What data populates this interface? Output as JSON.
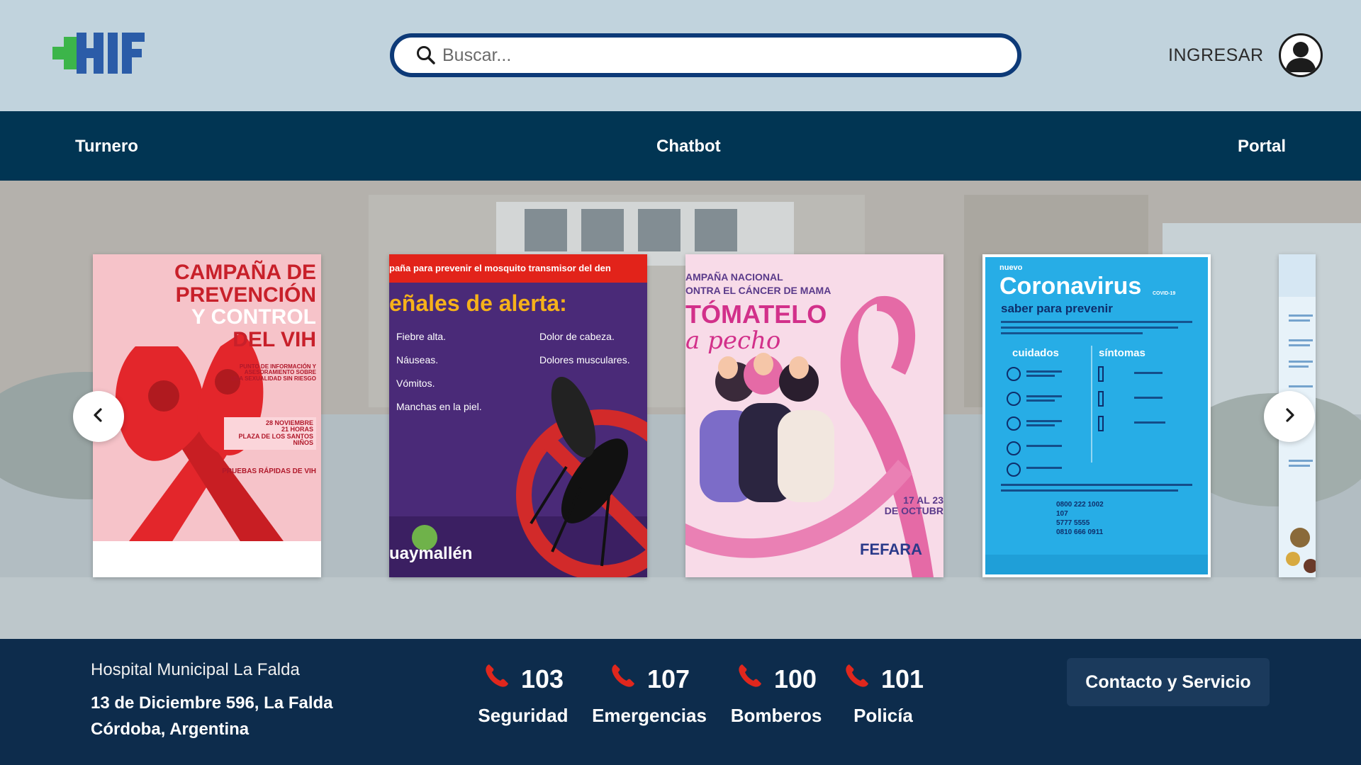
{
  "header": {
    "logo_text": "HIF",
    "search": {
      "placeholder": "Buscar..."
    },
    "login_label": "INGRESAR"
  },
  "navbar": {
    "items": [
      {
        "label": "Turnero"
      },
      {
        "label": "Chatbot"
      },
      {
        "label": "Portal"
      }
    ]
  },
  "carousel": {
    "slides": [
      {
        "lines": [
          "CAMPAÑA DE",
          "PREVENCIÓN",
          "Y CONTROL",
          "DEL VIH"
        ],
        "small": [
          "PUNTO DE INFORMACIÓN Y",
          "ASESORAMIENTO SOBRE",
          "UNA SEXUALIDAD SIN RIESGO"
        ],
        "date": [
          "28 NOVIEMBRE",
          "21 HORAS",
          "PLAZA DE LOS SANTOS NIÑOS"
        ],
        "tests": "PRUEBAS RÁPIDAS DE VIH"
      },
      {
        "banner": "paña para prevenir el mosquito transmisor del den",
        "heading": "eñales de alerta:",
        "signs_left": [
          "Fiebre alta.",
          "Náuseas.",
          "Vómitos.",
          "Manchas en la piel."
        ],
        "signs_right": [
          "Dolor de cabeza.",
          "Dolores musculares."
        ],
        "brand": "uaymallén"
      },
      {
        "line1": "AMPAÑA NACIONAL",
        "line2": "ONTRA EL CÁNCER DE MAMA",
        "title": "TÓMATELO",
        "subtitle": "a pecho",
        "date": [
          "17 AL 23",
          "DE OCTUBR"
        ],
        "brand": "FEFARA"
      },
      {
        "tag": "nuevo",
        "title": "Coronavirus",
        "title_sup": "COVID-19",
        "subtitle": "saber para prevenir",
        "col1": "cuidados",
        "col2": "síntomas",
        "phones": [
          "0800 222 1002",
          "107",
          "5777 5555",
          "0810 666 0911"
        ]
      }
    ]
  },
  "footer": {
    "hospital_name": "Hospital Municipal La Falda",
    "address_line1": "13 de Diciembre 596, La Falda",
    "address_line2": "Córdoba, Argentina",
    "emergency": [
      {
        "number": "103",
        "label": "Seguridad"
      },
      {
        "number": "107",
        "label": "Emergencias"
      },
      {
        "number": "100",
        "label": "Bomberos"
      },
      {
        "number": "101",
        "label": "Policía"
      }
    ],
    "contact_label": "Contacto y Servicio"
  },
  "colors": {
    "header_bg": "#c1d3dd",
    "nav_bg": "#013553",
    "footer_bg": "#0d2c4c",
    "logo_green": "#3cb54a",
    "logo_blue": "#2b5ca8",
    "search_border": "#0d3a78",
    "phone_red": "#e0271d"
  },
  "icons": {
    "search": "search-icon",
    "avatar": "user-avatar-icon",
    "phone": "phone-icon",
    "prev": "chevron-left-icon",
    "next": "chevron-right-icon"
  }
}
